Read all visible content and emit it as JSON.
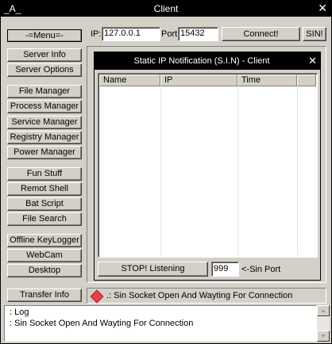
{
  "titlebar": {
    "logo": "_A_",
    "title": "Client",
    "close_icon": "close-icon"
  },
  "sidebar": {
    "menu_label": "-=Menu=-",
    "items": [
      "Server Info",
      "Server Options",
      "File Manager",
      "Process Manager",
      "Service Manager",
      "Registry Manager",
      "Power Manager",
      "Fun Stuff",
      "Remot Shell",
      "Bat Script",
      "File Search",
      "Offline KeyLogger",
      "WebCam",
      "Desktop",
      "Transfer Info"
    ]
  },
  "connection": {
    "ip_label": "IP:",
    "ip_value": "127.0.0.1",
    "port_label": "Port",
    "port_value": "15432",
    "connect_label": "Connect!",
    "sin_label": "SIN!"
  },
  "sin_window": {
    "title": "Static IP Notification (S.I.N) - Client",
    "columns": [
      "Name",
      "IP",
      "Time"
    ],
    "stop_label": "STOP! Listening",
    "sin_port_value": "999",
    "sin_port_label": "<-Sin Port"
  },
  "status": {
    "icon": "status-diamond-icon",
    "color": "#e8404a",
    "text": ".: Sin Socket Open And Wayting For Connection"
  },
  "log": {
    "lines": [
      ": Log",
      ": Sin Socket Open And Wayting For Connection"
    ]
  }
}
